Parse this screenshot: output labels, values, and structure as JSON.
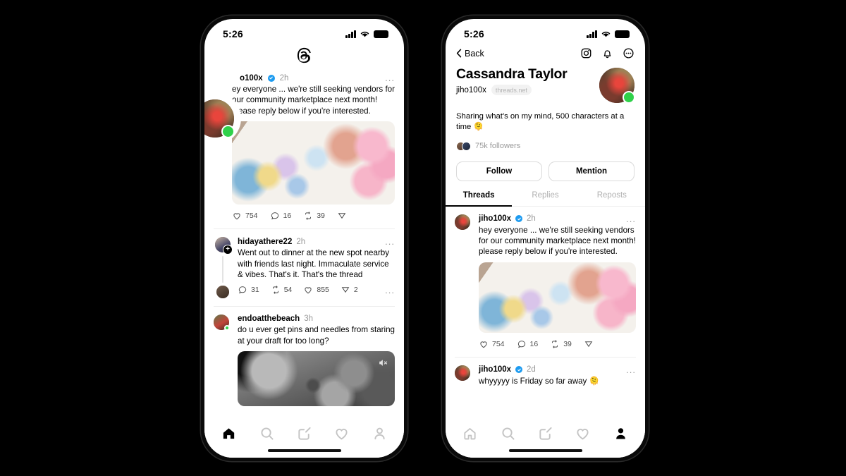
{
  "left_phone": {
    "status": {
      "time": "5:26",
      "signal": "signal-bars",
      "wifi": "wifi-icon",
      "battery": "battery-icon"
    },
    "logo": "threads-logo",
    "posts": [
      {
        "username": "jiho100x",
        "username_clipped": "o100x",
        "verified": true,
        "time": "2h",
        "text": "hey everyone ... we're still seeking vendors for our community marketplace next month! please reply below if you're interested.",
        "text_clipped": "ey everyone ... we're still seeking vendors for our community marketplace next month! please reply below if you're interested.",
        "media": "craft-photo",
        "actions": [
          {
            "icon": "heart-icon",
            "count": "754"
          },
          {
            "icon": "comment-icon",
            "count": "16"
          },
          {
            "icon": "repost-icon",
            "count": "39"
          },
          {
            "icon": "share-icon",
            "count": ""
          }
        ]
      },
      {
        "username": "hidayathere22",
        "verified": false,
        "time": "2h",
        "text": "Went out to dinner at the new spot nearby with friends last night. Immaculate service & vibes. That's it. That's the thread",
        "badge": "+",
        "actions": [
          {
            "icon": "comment-icon",
            "count": "31"
          },
          {
            "icon": "repost-icon",
            "count": "54"
          },
          {
            "icon": "heart-icon",
            "count": "855"
          },
          {
            "icon": "share-icon",
            "count": "2"
          }
        ],
        "more": "..."
      },
      {
        "username": "endoatthebeach",
        "verified": false,
        "time": "3h",
        "text": "do u ever get pins and needles from staring at your draft for too long?",
        "media": "moon-video",
        "muted": "mute-icon"
      }
    ],
    "nav": [
      {
        "name": "home",
        "icon": "home-icon",
        "active": true
      },
      {
        "name": "search",
        "icon": "search-icon",
        "active": false
      },
      {
        "name": "compose",
        "icon": "compose-icon",
        "active": false
      },
      {
        "name": "activity",
        "icon": "heart-icon",
        "active": false
      },
      {
        "name": "profile",
        "icon": "profile-icon",
        "active": false
      }
    ]
  },
  "right_phone": {
    "status": {
      "time": "5:26"
    },
    "back_label": "Back",
    "top_icons": [
      {
        "name": "instagram-icon"
      },
      {
        "name": "bell-icon"
      },
      {
        "name": "more-icon"
      }
    ],
    "profile": {
      "display_name": "Cassandra Taylor",
      "handle": "jiho100x",
      "domain_chip": "threads.net",
      "bio": "Sharing what's on my mind, 500 characters at a time 🫠",
      "followers": "75k followers",
      "online": true
    },
    "buttons": [
      {
        "label": "Follow"
      },
      {
        "label": "Mention"
      }
    ],
    "tabs": [
      {
        "label": "Threads",
        "active": true
      },
      {
        "label": "Replies",
        "active": false
      },
      {
        "label": "Reposts",
        "active": false
      }
    ],
    "posts": [
      {
        "username": "jiho100x",
        "verified": true,
        "time": "2h",
        "text": "hey everyone ... we're still seeking vendors for our community marketplace next month! please reply below if you're interested.",
        "media": "craft-photo",
        "actions": [
          {
            "icon": "heart-icon",
            "count": "754"
          },
          {
            "icon": "comment-icon",
            "count": "16"
          },
          {
            "icon": "repost-icon",
            "count": "39"
          },
          {
            "icon": "share-icon",
            "count": ""
          }
        ]
      },
      {
        "username": "jiho100x",
        "verified": true,
        "time": "2d",
        "text": "whyyyyy is Friday so far away 🫠"
      }
    ],
    "nav": [
      {
        "name": "home",
        "icon": "home-icon",
        "active": false
      },
      {
        "name": "search",
        "icon": "search-icon",
        "active": false
      },
      {
        "name": "compose",
        "icon": "compose-icon",
        "active": false
      },
      {
        "name": "activity",
        "icon": "heart-icon",
        "active": false
      },
      {
        "name": "profile",
        "icon": "profile-icon",
        "active": true
      }
    ]
  },
  "colors": {
    "background": "#000000",
    "screen": "#ffffff",
    "verified_blue": "#1d9bf0",
    "online_green": "#2fd14a",
    "muted_text": "#999999"
  }
}
